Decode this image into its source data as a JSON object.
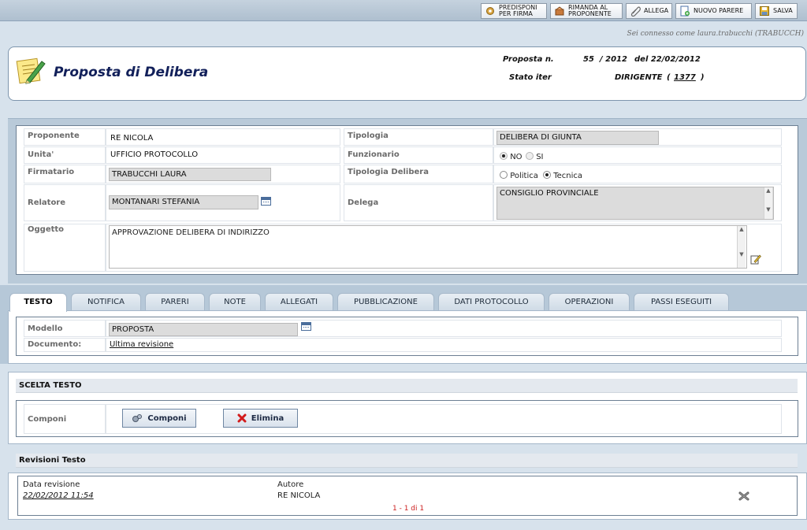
{
  "toolbar": {
    "buttons": [
      {
        "label": "PREDISPONI\nPER FIRMA",
        "icon": "gear-icon"
      },
      {
        "label": "RIMANDA AL\nPROPONENTE",
        "icon": "return-icon"
      },
      {
        "label": "ALLEGA",
        "icon": "paperclip-icon"
      },
      {
        "label": "NUOVO PARERE",
        "icon": "new-document-icon"
      },
      {
        "label": "SALVA",
        "icon": "save-icon"
      }
    ]
  },
  "user_line": "Sei connesso come laura.trabucchi (TRABUCCH)",
  "header": {
    "title": "Proposta di Delibera",
    "proposta_label": "Proposta n.",
    "proposta_num": "55",
    "proposta_year": "/ 2012",
    "proposta_date": "del 22/02/2012",
    "stato_label": "Stato iter",
    "stato_value": "DIRIGENTE",
    "stato_open": "(",
    "stato_link": "1377",
    "stato_close": ")"
  },
  "form": {
    "proponente_label": "Proponente",
    "proponente_value": "RE  NICOLA",
    "unita_label": "Unita'",
    "unita_value": "UFFICIO PROTOCOLLO",
    "firmatario_label": "Firmatario",
    "firmatario_value": "TRABUCCHI LAURA",
    "relatore_label": "Relatore",
    "relatore_value": "MONTANARI STEFANIA",
    "oggetto_label": "Oggetto",
    "oggetto_value": "APPROVAZIONE DELIBERA DI INDIRIZZO",
    "tipologia_label": "Tipologia",
    "tipologia_value": "DELIBERA DI GIUNTA",
    "funzionario_label": "Funzionario",
    "funzionario_no": "NO",
    "funzionario_si": "SI",
    "tipologia_delibera_label": "Tipologia Delibera",
    "politica_label": "Politica",
    "tecnica_label": "Tecnica",
    "delega_label": "Delega",
    "delega_value": "CONSIGLIO PROVINCIALE"
  },
  "tabs": [
    "TESTO",
    "NOTIFICA",
    "PARERI",
    "NOTE",
    "ALLEGATI",
    "PUBBLICAZIONE",
    "DATI PROTOCOLLO",
    "OPERAZIONI",
    "PASSI ESEGUITI"
  ],
  "testo": {
    "modello_label": "Modello",
    "modello_value": "PROPOSTA",
    "documento_label": "Documento:",
    "documento_link": "Ultima revisione"
  },
  "scelta": {
    "title": "SCELTA TESTO",
    "componi_label": "Componi",
    "componi_button": "Componi",
    "elimina_button": "Elimina"
  },
  "revisioni": {
    "title": "Revisioni Testo",
    "col_data": "Data revisione",
    "col_autore": "Autore",
    "row_data": "22/02/2012 11:54",
    "row_autore": "RE NICOLA",
    "pager": "1 - 1 di 1"
  }
}
